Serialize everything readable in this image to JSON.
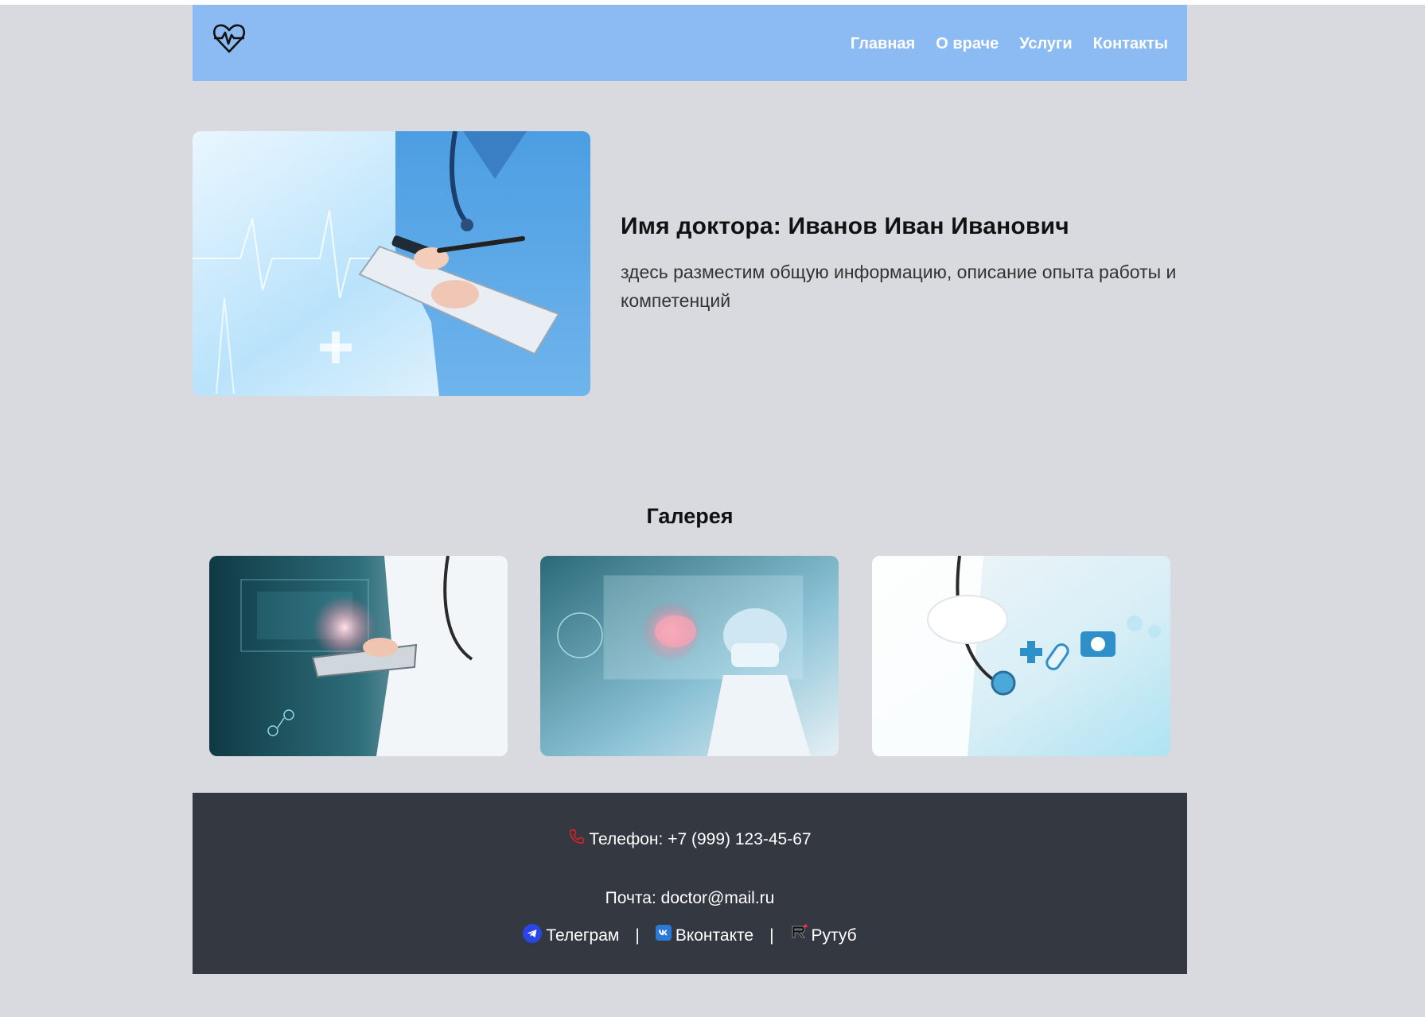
{
  "colors": {
    "page_background": "#d8dadf",
    "header_background": "#8bbbf2",
    "footer_background": "#343840",
    "phone_icon": "#d4222a",
    "telegram": "#2a45e6",
    "vk": "#2a79d6"
  },
  "header": {
    "logo_icon": "heart-pulse-icon",
    "nav": [
      {
        "label": "Главная"
      },
      {
        "label": "О враче"
      },
      {
        "label": "Услуги"
      },
      {
        "label": "Контакты"
      }
    ]
  },
  "about": {
    "image_icon": "doctor-clipboard-photo",
    "title": "Имя доктора: Иванов Иван Иванович",
    "description": "здесь разместим общую информацию, описание опыта работы и компетенций"
  },
  "gallery": {
    "title": "Галерея",
    "images": [
      {
        "icon": "doctor-tablet-photo"
      },
      {
        "icon": "surgeon-hologram-photo"
      },
      {
        "icon": "stethoscope-medical-icons-photo"
      }
    ]
  },
  "footer": {
    "phone_icon": "phone-icon",
    "phone_label": "Телефон:",
    "phone_value": "+7 (999) 123-45-67",
    "email_label": "Почта:",
    "email_value": "doctor@mail.ru",
    "links": [
      {
        "icon": "telegram-icon",
        "label": "Телеграм"
      },
      {
        "icon": "vk-icon",
        "label": "Вконтакте"
      },
      {
        "icon": "rutube-icon",
        "label": "Рутуб"
      }
    ],
    "separator": "|"
  }
}
